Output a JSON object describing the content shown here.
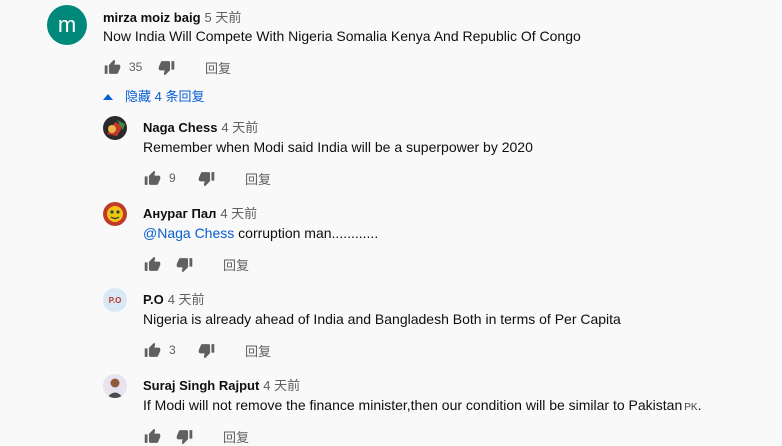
{
  "main_comment": {
    "avatar_letter": "m",
    "avatar_color": "#00897b",
    "author": "mirza moiz baig",
    "time": "5 天前",
    "text": "Now India Will Compete With Nigeria Somalia Kenya And Republic Of Congo",
    "likes": "35",
    "reply_label": "回复"
  },
  "replies_toggle": {
    "label": "隐藏 4 条回复",
    "color": "#065fd4"
  },
  "replies": [
    {
      "author": "Naga Chess",
      "time": "4 天前",
      "text": "Remember when Modi said India will be a superpower by 2020",
      "likes": "9",
      "reply_label": "回复"
    },
    {
      "author": "Анураг Пал",
      "time": "4 天前",
      "mention": "@Naga Chess",
      "text": " corruption man............",
      "likes": "",
      "reply_label": "回复"
    },
    {
      "author": "P.O",
      "avatar_text": "P.O",
      "time": "4 天前",
      "text": "Nigeria is already ahead of India and Bangladesh Both in terms of Per Capita",
      "likes": "3",
      "reply_label": "回复"
    },
    {
      "author": "Suraj Singh Rajput",
      "time": "4 天前",
      "text": "If Modi will not remove the finance minister,then our condition will be similar to Pakistan",
      "flag": "PK",
      "likes": "",
      "reply_label": "回复"
    }
  ]
}
